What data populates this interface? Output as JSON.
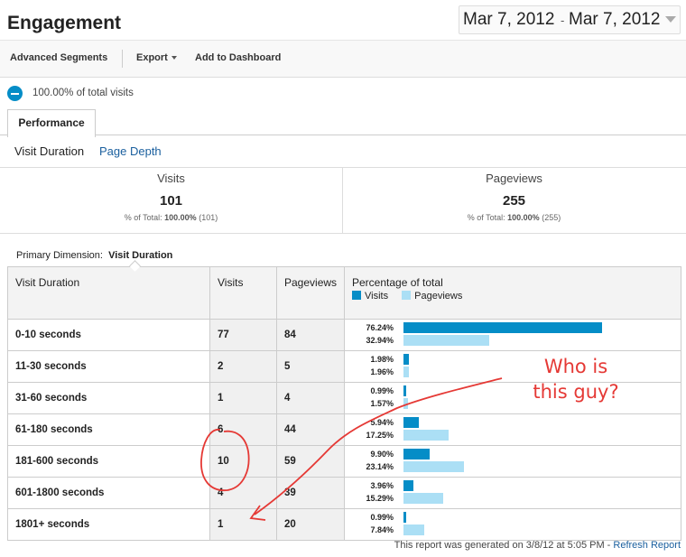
{
  "header": {
    "title": "Engagement",
    "date_start": "Mar 7, 2012",
    "date_separator": "-",
    "date_end": "Mar 7, 2012"
  },
  "toolbar": {
    "advanced_segments": "Advanced Segments",
    "export": "Export",
    "add_to_dashboard": "Add to Dashboard"
  },
  "segment": {
    "label": "100.00% of total visits"
  },
  "tabs": {
    "performance": "Performance"
  },
  "subnav": {
    "visit_duration": "Visit Duration",
    "page_depth": "Page Depth"
  },
  "summary": {
    "visits": {
      "label": "Visits",
      "value": "101",
      "sub_prefix": "% of Total:",
      "sub_pct": "100.00%",
      "sub_total": "(101)"
    },
    "pageviews": {
      "label": "Pageviews",
      "value": "255",
      "sub_prefix": "% of Total:",
      "sub_pct": "100.00%",
      "sub_total": "(255)"
    }
  },
  "primary_dimension": {
    "label": "Primary Dimension:",
    "value": "Visit Duration"
  },
  "table": {
    "headers": {
      "dimension": "Visit Duration",
      "visits": "Visits",
      "pageviews": "Pageviews",
      "percentage": "Percentage of total"
    },
    "legend": {
      "visits": "Visits",
      "pageviews": "Pageviews"
    },
    "rows": [
      {
        "duration": "0-10 seconds",
        "visits": "77",
        "pageviews": "84",
        "visits_pct_label": "76.24%",
        "pageviews_pct_label": "32.94%",
        "visits_pct": 76.24,
        "pageviews_pct": 32.94
      },
      {
        "duration": "11-30 seconds",
        "visits": "2",
        "pageviews": "5",
        "visits_pct_label": "1.98%",
        "pageviews_pct_label": "1.96%",
        "visits_pct": 1.98,
        "pageviews_pct": 1.96
      },
      {
        "duration": "31-60 seconds",
        "visits": "1",
        "pageviews": "4",
        "visits_pct_label": "0.99%",
        "pageviews_pct_label": "1.57%",
        "visits_pct": 0.99,
        "pageviews_pct": 1.57
      },
      {
        "duration": "61-180 seconds",
        "visits": "6",
        "pageviews": "44",
        "visits_pct_label": "5.94%",
        "pageviews_pct_label": "17.25%",
        "visits_pct": 5.94,
        "pageviews_pct": 17.25
      },
      {
        "duration": "181-600 seconds",
        "visits": "10",
        "pageviews": "59",
        "visits_pct_label": "9.90%",
        "pageviews_pct_label": "23.14%",
        "visits_pct": 9.9,
        "pageviews_pct": 23.14
      },
      {
        "duration": "601-1800 seconds",
        "visits": "4",
        "pageviews": "39",
        "visits_pct_label": "3.96%",
        "pageviews_pct_label": "15.29%",
        "visits_pct": 3.96,
        "pageviews_pct": 15.29
      },
      {
        "duration": "1801+ seconds",
        "visits": "1",
        "pageviews": "20",
        "visits_pct_label": "0.99%",
        "pageviews_pct_label": "7.84%",
        "visits_pct": 0.99,
        "pageviews_pct": 7.84
      }
    ]
  },
  "footer": {
    "generated": "This report was generated on 3/8/12 at 5:05 PM -",
    "refresh": "Refresh Report"
  },
  "annotation": {
    "line1": "Who is",
    "line2": "this guy?"
  },
  "colors": {
    "visits_bar": "#058dc7",
    "pageviews_bar": "#abdff5",
    "annotation": "#e53935",
    "link": "#1a5f9e"
  }
}
